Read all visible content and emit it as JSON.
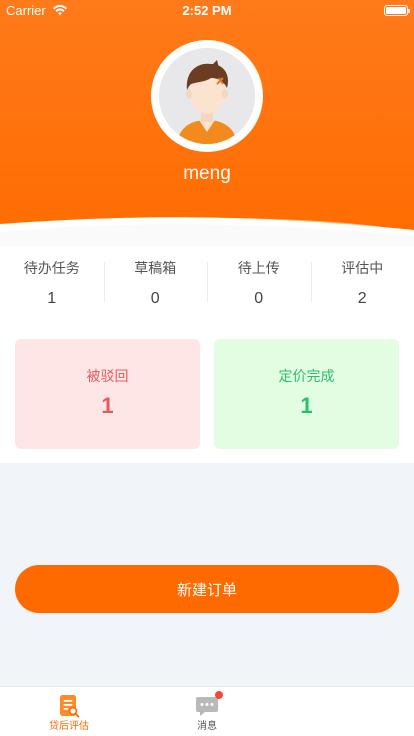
{
  "status_bar": {
    "carrier": "Carrier",
    "time": "2:52 PM"
  },
  "profile": {
    "username": "meng"
  },
  "stats": [
    {
      "label": "待办任务",
      "value": "1"
    },
    {
      "label": "草稿箱",
      "value": "0"
    },
    {
      "label": "待上传",
      "value": "0"
    },
    {
      "label": "评估中",
      "value": "2"
    }
  ],
  "summary": {
    "rejected": {
      "label": "被驳回",
      "value": "1",
      "color": "#e55a5a",
      "bg": "#ffe6e6"
    },
    "priced": {
      "label": "定价完成",
      "value": "1",
      "color": "#2bbf6b",
      "bg": "#e3fde3"
    }
  },
  "actions": {
    "new_order_label": "新建订单"
  },
  "tabbar": {
    "items": [
      {
        "label": "贷后评估",
        "icon": "document-search-icon",
        "active": true
      },
      {
        "label": "消息",
        "icon": "chat-bubble-icon",
        "active": false,
        "badge": true
      }
    ]
  },
  "colors": {
    "accent": "#ff6a00",
    "header": "#ff7a1a"
  }
}
